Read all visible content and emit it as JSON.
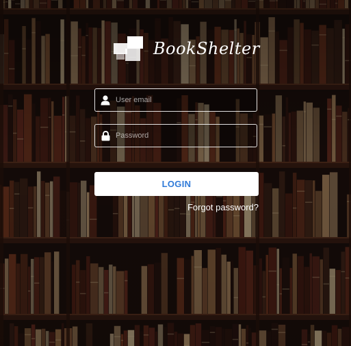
{
  "app": {
    "logo_text": "BookShelter",
    "logo_icon": "stacked-squares-logo-icon"
  },
  "form": {
    "email": {
      "value": "",
      "placeholder": "User email",
      "icon": "user-icon"
    },
    "password": {
      "value": "",
      "placeholder": "Password",
      "icon": "lock-icon"
    },
    "login_label": "LOGIN",
    "forgot_label": "Forgot password?"
  },
  "colors": {
    "background": "#1d100c",
    "field_border": "#ffffff",
    "button_bg": "#ffffff",
    "button_text": "#2f7ad8",
    "text": "#ffffff"
  }
}
